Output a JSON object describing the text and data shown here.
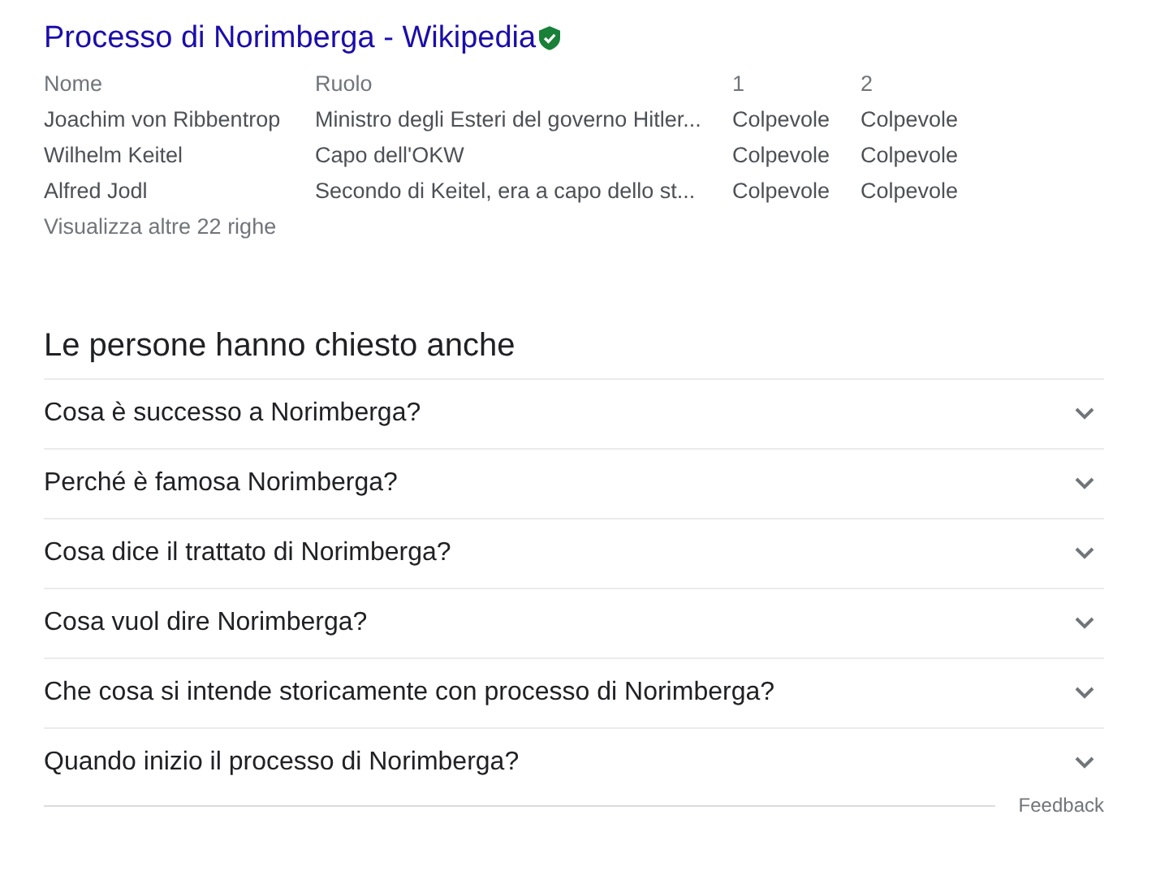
{
  "result": {
    "title": "Processo di Norimberga - Wikipedia",
    "verified": true
  },
  "table": {
    "columns": [
      "Nome",
      "Ruolo",
      "1",
      "2"
    ],
    "rows": [
      [
        "Joachim von Ribbentrop",
        "Ministro degli Esteri del governo Hitler...",
        "Colpevole",
        "Colpevole"
      ],
      [
        "Wilhelm Keitel",
        "Capo dell'OKW",
        "Colpevole",
        "Colpevole"
      ],
      [
        "Alfred Jodl",
        "Secondo di Keitel, era a capo dello st...",
        "Colpevole",
        "Colpevole"
      ]
    ],
    "more_link": "Visualizza altre 22 righe"
  },
  "people_also_ask": {
    "heading": "Le persone hanno chiesto anche",
    "questions": [
      {
        "text": "Cosa è successo a Norimberga?",
        "expanded": false
      },
      {
        "text": "Perché è famosa Norimberga?",
        "expanded": false
      },
      {
        "text": "Cosa dice il trattato di Norimberga?",
        "expanded": false
      },
      {
        "text": "Cosa vuol dire Norimberga?",
        "expanded": false
      },
      {
        "text": "Che cosa si intende storicamente con processo di Norimberga?",
        "expanded": false
      },
      {
        "text": "Quando inizio il processo di Norimberga?",
        "expanded": false
      }
    ],
    "feedback": "Feedback"
  }
}
